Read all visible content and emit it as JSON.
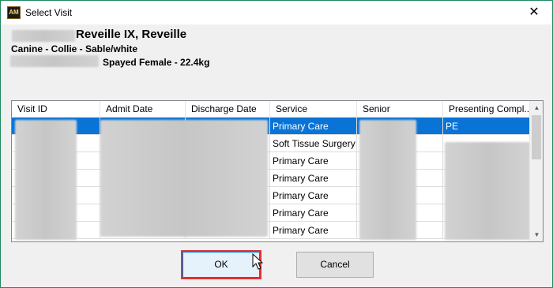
{
  "window": {
    "title": "Select Visit",
    "app_icon": "AM",
    "close_glyph": "✕"
  },
  "patient": {
    "name": "Reveille IX, Reveille",
    "breed_line": "Canine - Collie - Sable/white",
    "sex_weight": "Spayed Female - 22.4kg"
  },
  "grid": {
    "columns": [
      "Visit ID",
      "Admit Date",
      "Discharge Date",
      "Service",
      "Senior",
      "Presenting Compl..."
    ],
    "rows": [
      {
        "service": "Primary Care",
        "complaint": "PE",
        "selected": true
      },
      {
        "service": "Soft Tissue Surgery",
        "complaint": ""
      },
      {
        "service": "Primary Care",
        "complaint": ""
      },
      {
        "service": "Primary Care",
        "complaint": ""
      },
      {
        "service": "Primary Care",
        "complaint": ""
      },
      {
        "service": "Primary Care",
        "complaint": ""
      },
      {
        "service": "Primary Care",
        "complaint": ""
      }
    ]
  },
  "buttons": {
    "ok": "OK",
    "cancel": "Cancel"
  },
  "colors": {
    "selection": "#0a74d6",
    "highlight_border": "#d8363c",
    "window_border": "#1e8a5e"
  }
}
